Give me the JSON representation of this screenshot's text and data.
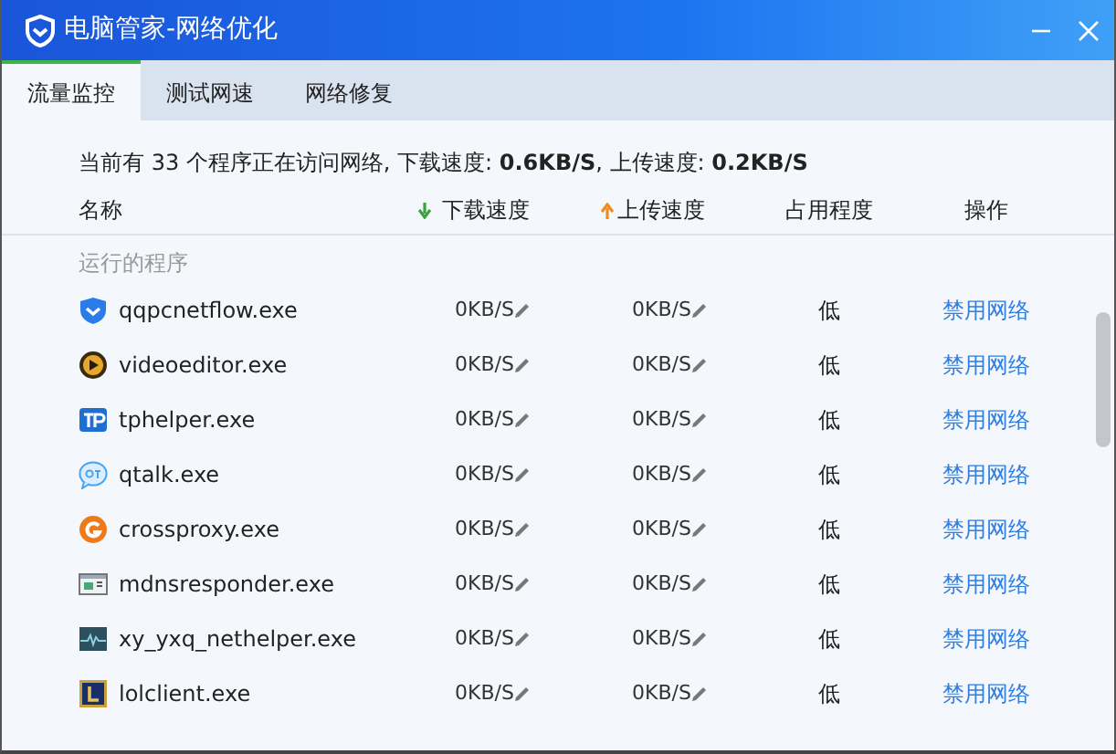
{
  "window": {
    "title": "电脑管家-网络优化"
  },
  "tabs": [
    {
      "label": "流量监控",
      "selected": true
    },
    {
      "label": "测试网速",
      "selected": false
    },
    {
      "label": "网络修复",
      "selected": false
    }
  ],
  "summary": "当前有 33 个程序正在访问网络, 下载速度: **0.6KB/S**, 上传速度: **0.2KB/S**",
  "columns": [
    {
      "label": "名称",
      "kind": "plain"
    },
    {
      "label": "下载速度",
      "kind": "download"
    },
    {
      "label": "上传速度",
      "kind": "upload"
    },
    {
      "label": "占用程度",
      "kind": "plain"
    },
    {
      "label": "操作",
      "kind": "plain"
    }
  ],
  "group": "运行的程序",
  "rows": [
    {
      "kind": "shield",
      "name": "qqpcnetflow.exe",
      "download": "0KB/S",
      "upload": "0KB/S",
      "usage": "低",
      "action": "禁用网络"
    },
    {
      "kind": "play",
      "name": "videoeditor.exe",
      "download": "0KB/S",
      "upload": "0KB/S",
      "usage": "低",
      "action": "禁用网络"
    },
    {
      "kind": "tp",
      "name": "tphelper.exe",
      "download": "0KB/S",
      "upload": "0KB/S",
      "usage": "低",
      "action": "禁用网络"
    },
    {
      "kind": "bubble",
      "name": "qtalk.exe",
      "download": "0KB/S",
      "upload": "0KB/S",
      "usage": "低",
      "action": "禁用网络"
    },
    {
      "kind": "swirl",
      "name": "crossproxy.exe",
      "download": "0KB/S",
      "upload": "0KB/S",
      "usage": "低",
      "action": "禁用网络"
    },
    {
      "kind": "window",
      "name": "mdnsresponder.exe",
      "download": "0KB/S",
      "upload": "0KB/S",
      "usage": "低",
      "action": "禁用网络"
    },
    {
      "kind": "wave",
      "name": "xy_yxq_nethelper.exe",
      "download": "0KB/S",
      "upload": "0KB/S",
      "usage": "低",
      "action": "禁用网络"
    },
    {
      "kind": "letter",
      "name": "lolclient.exe",
      "download": "0KB/S",
      "upload": "0KB/S",
      "usage": "低",
      "action": "禁用网络"
    }
  ]
}
